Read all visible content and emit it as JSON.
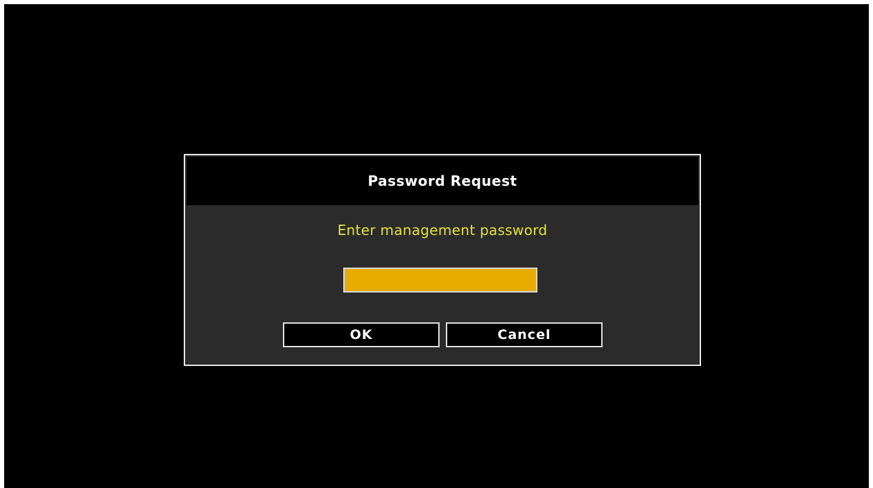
{
  "dialog": {
    "title": "Password Request",
    "prompt": "Enter management password",
    "password_value": "",
    "ok_label": "OK",
    "cancel_label": "Cancel"
  },
  "colors": {
    "screen_background": "#000000",
    "dialog_background": "#2b2b2b",
    "dialog_border": "#e8e8e8",
    "prompt_text": "#e8e03a",
    "input_fill": "#e6ac00"
  }
}
